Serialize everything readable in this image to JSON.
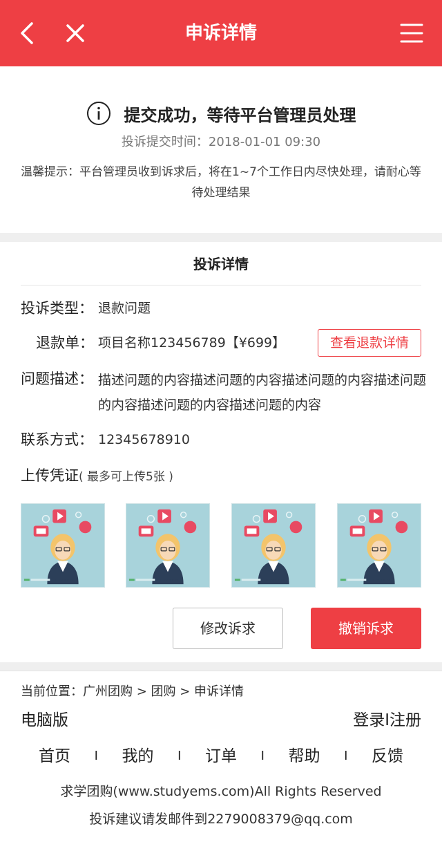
{
  "header": {
    "title": "申诉详情",
    "back_icon": "back-icon",
    "close_icon": "close-icon",
    "menu_icon": "menu-icon",
    "bg_color": "#ee3f44"
  },
  "status": {
    "icon": "info-icon",
    "title": "提交成功，等待平台管理员处理",
    "submit_time": "投诉提交时间：2018-01-01 09:30",
    "tip": "温馨提示：平台管理员收到诉求后，将在1~7个工作日内尽快处理，请耐心等待处理结果"
  },
  "detail": {
    "section_title": "投诉详情",
    "type_label": "投诉类型：",
    "type_value": "退款问题",
    "refund_label": "退款单：",
    "refund_value": "项目名称123456789【¥699】",
    "refund_button": "查看退款详情",
    "desc_label": "问题描述：",
    "desc_value": "描述问题的内容描述问题的内容描述问题的内容描述问题的内容描述问题的内容描述问题的内容",
    "contact_label": "联系方式：",
    "contact_value": "12345678910",
    "upload_label": "上传凭证",
    "upload_note": "( 最多可上传5张 )",
    "images": [
      "TEACHER",
      "TEACHER",
      "TEACHER",
      "TEACHER"
    ],
    "modify_button": "修改诉求",
    "cancel_button": "撤销诉求"
  },
  "footer": {
    "breadcrumb": "当前位置：广州团购 > 团购 > 申诉详情",
    "pc_version": "电脑版",
    "login": "登录",
    "auth_sep": "I",
    "register": "注册",
    "nav": [
      "首页",
      "我的",
      "订单",
      "帮助",
      "反馈"
    ],
    "nav_sep": "I",
    "copyright": "求学团购(www.studyems.com)All Rights Reserved",
    "email_note": "投诉建议请发邮件到2279008379@qq.com"
  }
}
